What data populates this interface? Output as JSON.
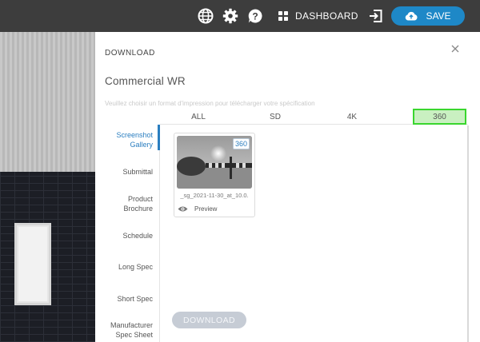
{
  "topbar": {
    "icons": [
      "globe-icon",
      "gear-icon",
      "help-icon",
      "dashboard-grid-icon",
      "exit-icon",
      "cloud-upload-icon"
    ],
    "dashboard_label": "DASHBOARD",
    "save_label": "SAVE",
    "save_color": "#1e88c7"
  },
  "dialog": {
    "title": "DOWNLOAD",
    "product_name": "Commercial WR",
    "hint": "Veuillez choisir un format d'impression pour télécharger votre spécification",
    "tabs": [
      {
        "label": "ALL",
        "active": false
      },
      {
        "label": "SD",
        "active": false
      },
      {
        "label": "4K",
        "active": false
      },
      {
        "label": "360",
        "active": true
      }
    ],
    "active_tab_color": "#39d62e",
    "nav": [
      {
        "label": "Screenshot\nGallery",
        "active": true
      },
      {
        "label": "Submittal",
        "active": false
      },
      {
        "label": "Product\nBrochure",
        "active": false
      },
      {
        "label": "Schedule",
        "active": false
      },
      {
        "label": "Long Spec",
        "active": false
      },
      {
        "label": "Short Spec",
        "active": false
      },
      {
        "label": "Manufacturer\nSpec Sheet",
        "active": false
      }
    ],
    "gallery": [
      {
        "badge": "360",
        "filename": "_sg_2021-11-30_at_10.0.",
        "preview_label": "Preview"
      }
    ],
    "download_label": "DOWNLOAD",
    "accent_color": "#2a7ec0"
  }
}
